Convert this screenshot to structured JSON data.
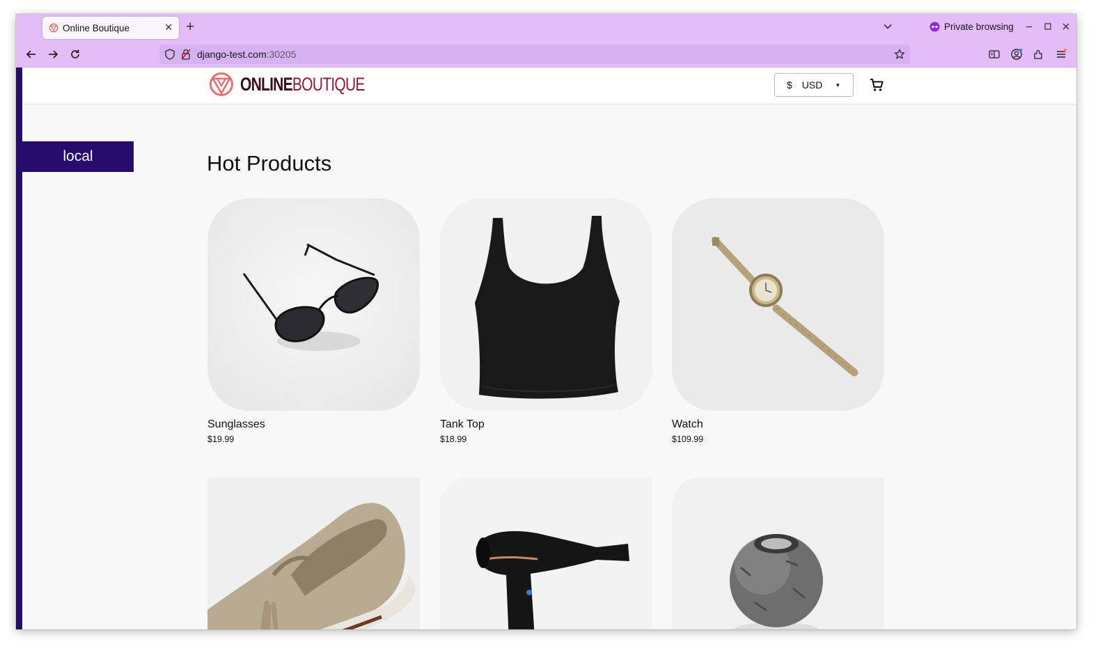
{
  "browser": {
    "tab_title": "Online Boutique",
    "private_label": "Private browsing",
    "url_host": "django-test.com",
    "url_port": ":30205"
  },
  "header": {
    "logo_part1": "ONLINE",
    "logo_part2": "BOUTIQUE",
    "currency_symbol": "$",
    "currency_code": "USD"
  },
  "env_badge": "local",
  "section_title": "Hot Products",
  "products": [
    {
      "name": "Sunglasses",
      "price": "$19.99",
      "icon": "sunglasses"
    },
    {
      "name": "Tank Top",
      "price": "$18.99",
      "icon": "tank-top"
    },
    {
      "name": "Watch",
      "price": "$109.99",
      "icon": "watch"
    },
    {
      "name": "",
      "price": "",
      "icon": "loafers"
    },
    {
      "name": "",
      "price": "",
      "icon": "hair-dryer"
    },
    {
      "name": "",
      "price": "",
      "icon": "candle-holder"
    }
  ],
  "colors": {
    "chrome": "#e3bcf8",
    "accent": "#260a6c",
    "brand": "#8c1b3a"
  }
}
